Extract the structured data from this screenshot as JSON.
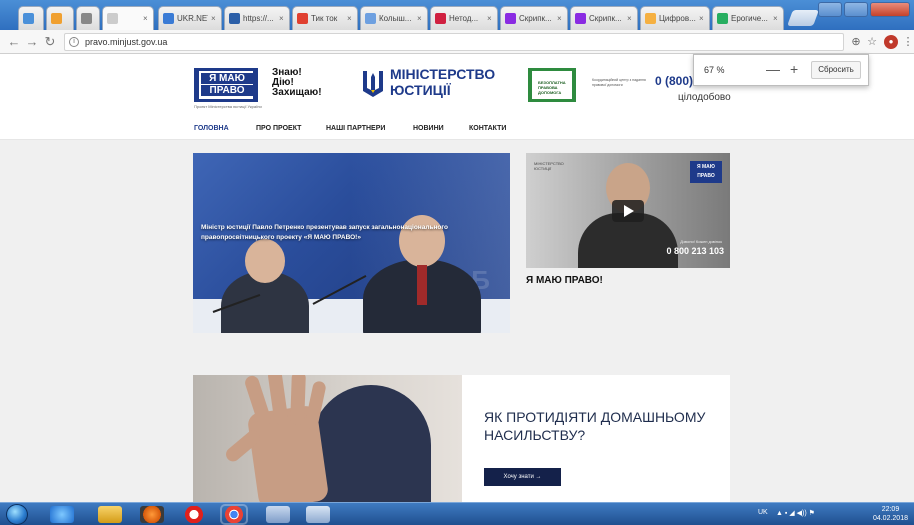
{
  "browser": {
    "tabs": [
      {
        "title": "",
        "color": "#4a90d9"
      },
      {
        "title": "",
        "color": "#f0a030"
      },
      {
        "title": "",
        "color": "#888888"
      },
      {
        "title": "",
        "color": "#cccccc"
      },
      {
        "title": "UKR.NET",
        "color": "#3a7bd5"
      },
      {
        "title": "https://...",
        "color": "#2b5fa8"
      },
      {
        "title": "Тик ток",
        "color": "#e04030"
      },
      {
        "title": "Колыш...",
        "color": "#6ea0e0"
      },
      {
        "title": "Нетод...",
        "color": "#d02040"
      },
      {
        "title": "Скрипк...",
        "color": "#8a2be2"
      },
      {
        "title": "Скрипк...",
        "color": "#8a2be2"
      },
      {
        "title": "Цифров...",
        "color": "#f5b041"
      },
      {
        "title": "Ерогиче...",
        "color": "#27ae60"
      }
    ],
    "url": "pravo.minjust.gov.ua",
    "zoom": {
      "value": "67 %",
      "minus": "—",
      "plus": "+",
      "reset": "Сбросить"
    }
  },
  "header": {
    "logo_line1": "Я МАЮ",
    "logo_line2": "ПРАВО",
    "logo_sub": "Проект Міністерства юстиції України",
    "slogan": [
      "Знаю!",
      "Дію!",
      "Захищаю!"
    ],
    "ministry_line1": "МІНІСТЕРСТВО",
    "ministry_line2": "ЮСТИЦІЇ",
    "legal_aid_label": "БЕЗОПЛАТНА ПРАВОВА ДОПОМОГА",
    "legal_aid_desc": "Координаційний центр з надання правової допомоги",
    "hotline": "0 (800)",
    "hotline_sub": "цілодобово"
  },
  "nav": {
    "items": [
      "ГОЛОВНА",
      "ПРО ПРОЕКТ",
      "НАШІ ПАРТНЕРИ",
      "НОВИНИ",
      "КОНТАКТИ"
    ]
  },
  "hero": {
    "caption": "Міністр юстиції Павло Петренко презентував запуск загальнонаціонального правопросвітницького проекту «Я МАЮ ПРАВО!»",
    "wall_text": "КАБ"
  },
  "video": {
    "badge": "Я МАЮ ПРАВО",
    "logo_left": "МІНІСТЕРСТВО ЮСТИЦІЇ",
    "note": "Дзвони! Кожен дзвінок",
    "phone": "0 800 213 103",
    "title": "Я МАЮ ПРАВО!"
  },
  "violence": {
    "title": "ЯК ПРОТИДІЯТИ ДОМАШНЬОМУ НАСИЛЬСТВУ?",
    "button": "Хочу знати →"
  },
  "taskbar": {
    "lang": "UK",
    "time": "22:09",
    "date": "04.02.2018"
  }
}
